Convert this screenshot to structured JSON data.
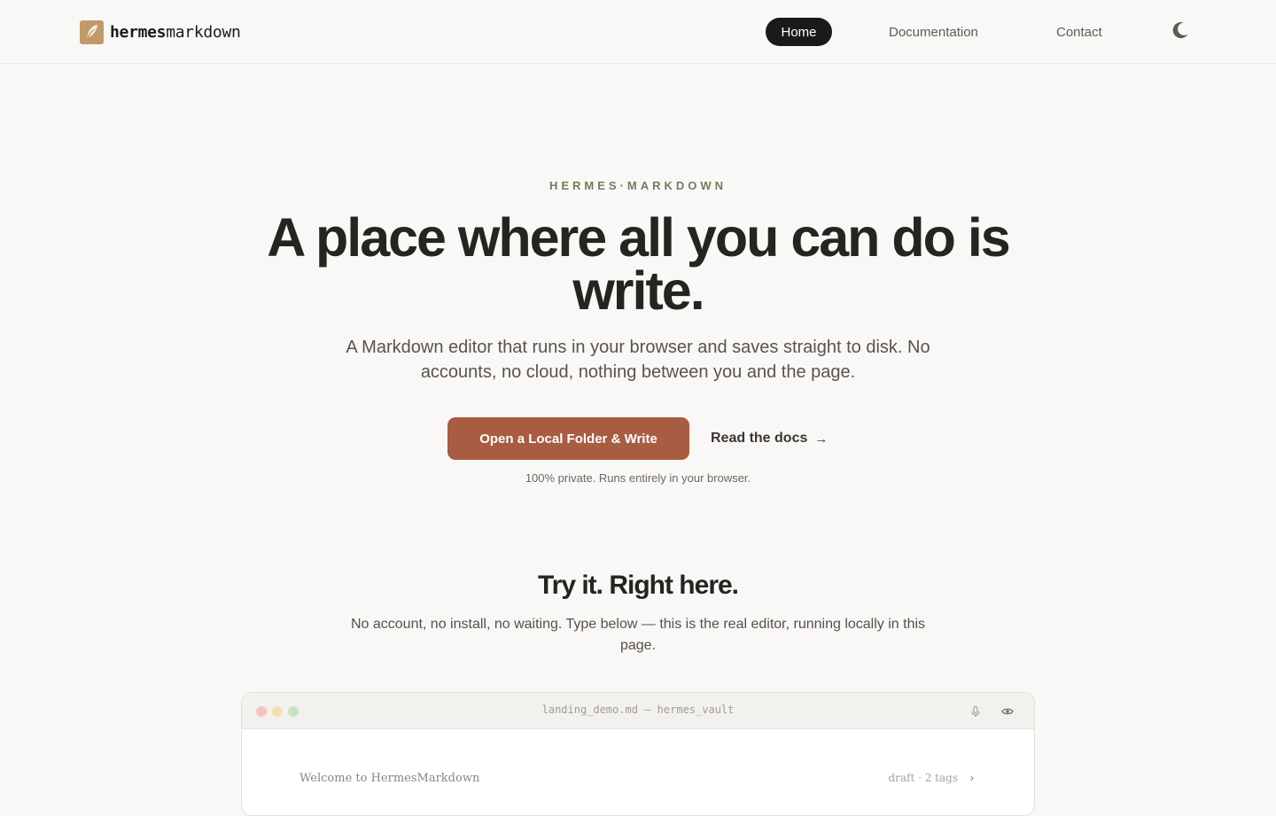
{
  "brand": {
    "name_bold": "hermes",
    "name_light": "markdown",
    "logo_icon": "feather-icon",
    "logo_color": "#c19a6b"
  },
  "nav": {
    "items": [
      {
        "label": "Home",
        "active": true
      },
      {
        "label": "Documentation",
        "active": false
      },
      {
        "label": "Contact",
        "active": false
      }
    ],
    "theme_toggle_icon": "moon-icon"
  },
  "hero": {
    "eyebrow": "HERMES·MARKDOWN",
    "headline": "A place where all you can do is write.",
    "subhead": "A Markdown editor that runs in your browser and saves straight to disk. No accounts, no cloud, nothing between you and the page.",
    "cta_primary": "Open a Local Folder & Write",
    "cta_secondary": "Read the docs",
    "cta_secondary_arrow": "→",
    "privacy_note": "100% private. Runs entirely in your browser."
  },
  "try_section": {
    "title": "Try it. Right here.",
    "description": "No account, no install, no waiting. Type below — this is the real editor, running locally in this page."
  },
  "editor": {
    "filename": "landing_demo.md — hermes_vault",
    "toolbar_icons": [
      "microphone-icon",
      "eye-icon"
    ],
    "doc_title": "Welcome to HermesMarkdown",
    "doc_status": "draft · 2 tags",
    "chevron": "›"
  },
  "colors": {
    "background": "#f9f8f6",
    "accent": "#a85c42",
    "eyebrow": "#6f7f5a",
    "dark_pill": "#1b1a18"
  }
}
